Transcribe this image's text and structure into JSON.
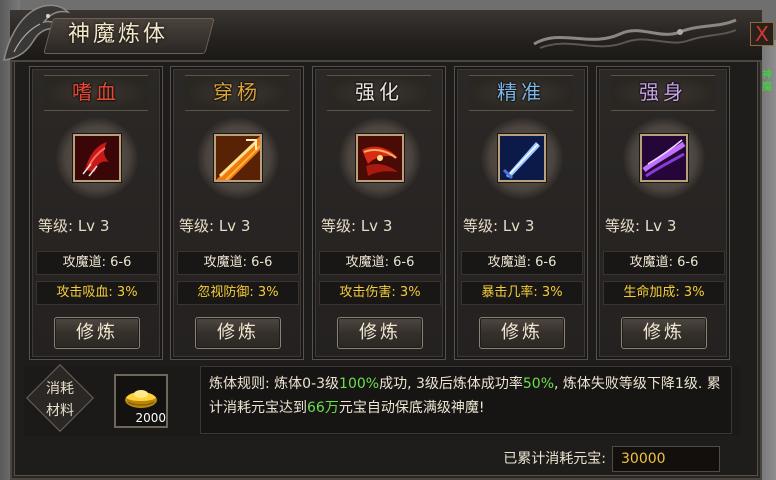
{
  "window": {
    "title": "神魔炼体",
    "close_label": "X"
  },
  "colors": {
    "title_card_1": "#e84a34",
    "title_card_2": "#d9a23a",
    "title_card_3": "#e8e6e0",
    "title_card_4": "#7fb6e6",
    "title_card_5": "#c8a2e8",
    "stat_accent": "#f4cc38",
    "highlight_green": "#6cdf4e",
    "total_value": "#f0c240"
  },
  "cards": [
    {
      "title": "嗜血",
      "icon": "blood-claw-icon",
      "level": "等级: Lv 3",
      "stat1": "攻魔道: 6-6",
      "stat2": "攻击吸血: 3%",
      "button": "修炼"
    },
    {
      "title": "穿杨",
      "icon": "flaming-arrow-icon",
      "level": "等级: Lv 3",
      "stat1": "攻魔道: 6-6",
      "stat2": "忽视防御: 3%",
      "button": "修炼"
    },
    {
      "title": "强化",
      "icon": "fire-blade-icon",
      "level": "等级: Lv 3",
      "stat1": "攻魔道: 6-6",
      "stat2": "攻击伤害: 3%",
      "button": "修炼"
    },
    {
      "title": "精准",
      "icon": "blue-sword-icon",
      "level": "等级: Lv 3",
      "stat1": "攻魔道: 6-6",
      "stat2": "暴击几率: 3%",
      "button": "修炼"
    },
    {
      "title": "强身",
      "icon": "purple-energy-icon",
      "level": "等级: Lv 3",
      "stat1": "攻魔道: 6-6",
      "stat2": "生命加成: 3%",
      "button": "修炼"
    }
  ],
  "materials": {
    "label_line1": "消耗",
    "label_line2": "材料",
    "item_icon": "gold-ingot-icon",
    "item_count": "2000"
  },
  "rules": {
    "prefix": "炼体规则: 炼体0-3级",
    "rate1": "100%",
    "mid1": "成功, 3级后炼体成功率",
    "rate2": "50%",
    "mid2": ", 炼体失败等级下降1级. 累计消耗元宝达到",
    "amount": "66万",
    "suffix": "元宝自动保底满级神魔!"
  },
  "total": {
    "label": "已累计消耗元宝:",
    "value": "30000"
  },
  "side": {
    "left_badge": "",
    "right_badge": "神魔"
  }
}
